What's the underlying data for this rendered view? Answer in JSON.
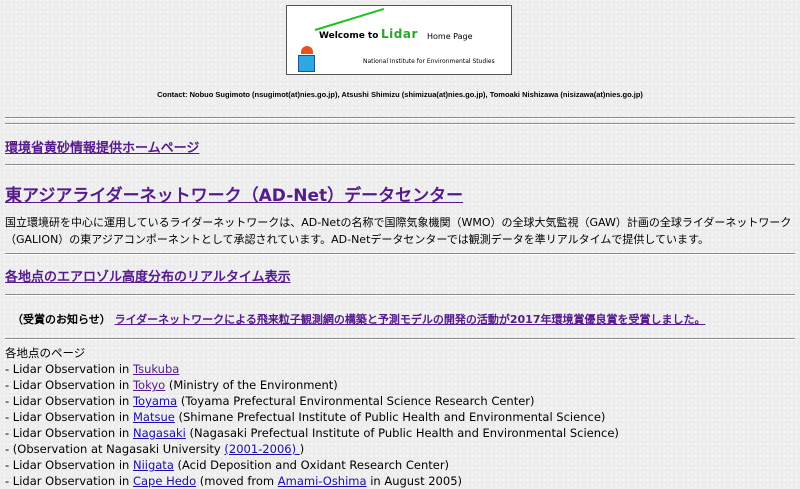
{
  "banner": {
    "welcome": "Welcome to",
    "lidar": "Lidar",
    "home_page": "Home Page",
    "institute": "National Institute for Environmental Studies"
  },
  "contact": "Contact: Nobuo Sugimoto (nsugimot(at)nies.go.jp), Atsushi Shimizu (shimizua(at)nies.go.jp), Tomoaki Nishizawa (nisizawa(at)nies.go.jp)",
  "links": {
    "kosa": "環境省黄砂情報提供ホームページ",
    "adnet": "東アジアライダーネットワーク（AD-Net）データセンター",
    "realtime": "各地点のエアロゾル高度分布のリアルタイム表示"
  },
  "description": "国立環境研を中心に運用しているライダーネットワークは、AD-Netの名称で国際気象機関（WMO）の全球大気監視（GAW）計画の全球ライダーネットワーク（GALION）の東アジアコンポーネントとして承認されています。AD-Netデータセンターでは観測データを準リアルタイムで提供しています。",
  "award": {
    "prefix": "（受賞のお知らせ）",
    "link": "ライダーネットワークによる飛来粒子観測網の構築と予測モデルの開発の活動が2017年環境賞優良賞を受賞しました。"
  },
  "sites": {
    "heading": "各地点のページ",
    "items": [
      {
        "prefix": "- Lidar Observation in ",
        "link": "Tsukuba",
        "suffix": ""
      },
      {
        "prefix": "- Lidar Observation in ",
        "link": "Tokyo",
        "suffix": " (Ministry of the Environment)"
      },
      {
        "prefix": "- Lidar Observation in ",
        "link": "Toyama",
        "suffix": " (Toyama Prefectural Environmental Science Research Center)"
      },
      {
        "prefix": "- Lidar Observation in ",
        "link": "Matsue",
        "suffix": " (Shimane Prefectual Institute of Public Health and Environmental Science)"
      },
      {
        "prefix": "- Lidar Observation in ",
        "link": "Nagasaki",
        "suffix": " (Nagasaki Prefectual Institute of Public Health and Environmental Science)"
      },
      {
        "prefix": "- (Observation at Nagasaki University ",
        "link": "(2001-2006) ",
        "suffix": ")"
      },
      {
        "prefix": "- Lidar Observation in ",
        "link": "Niigata",
        "suffix": " (Acid Deposition and Oxidant Research Center)"
      },
      {
        "prefix": "- Lidar Observation in ",
        "link": "Cape Hedo",
        "suffix": " (moved from ",
        "link2": "Amami-Oshima",
        "suffix2": " in August 2005)"
      }
    ]
  }
}
